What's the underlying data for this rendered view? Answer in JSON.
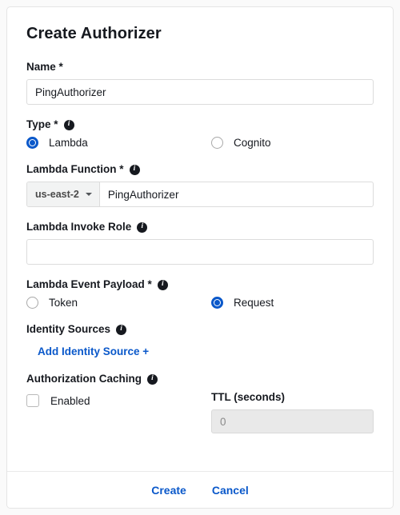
{
  "form": {
    "title": "Create Authorizer",
    "name": {
      "label": "Name *",
      "value": "PingAuthorizer"
    },
    "type": {
      "label": "Type *",
      "options": [
        {
          "label": "Lambda",
          "selected": true
        },
        {
          "label": "Cognito",
          "selected": false
        }
      ]
    },
    "lambda_function": {
      "label": "Lambda Function *",
      "region": "us-east-2",
      "value": "PingAuthorizer"
    },
    "lambda_invoke_role": {
      "label": "Lambda Invoke Role",
      "value": ""
    },
    "lambda_event_payload": {
      "label": "Lambda Event Payload *",
      "options": [
        {
          "label": "Token",
          "selected": false
        },
        {
          "label": "Request",
          "selected": true
        }
      ]
    },
    "identity_sources": {
      "label": "Identity Sources",
      "add_link": "Add Identity Source +"
    },
    "authorization_caching": {
      "label": "Authorization Caching",
      "enabled_label": "Enabled",
      "enabled_checked": false,
      "ttl_label": "TTL (seconds)",
      "ttl_placeholder": "0",
      "ttl_value": ""
    }
  },
  "footer": {
    "create_label": "Create",
    "cancel_label": "Cancel"
  },
  "colors": {
    "accent": "#0a58ca",
    "text": "#16191f",
    "border": "#dcdcdc"
  }
}
